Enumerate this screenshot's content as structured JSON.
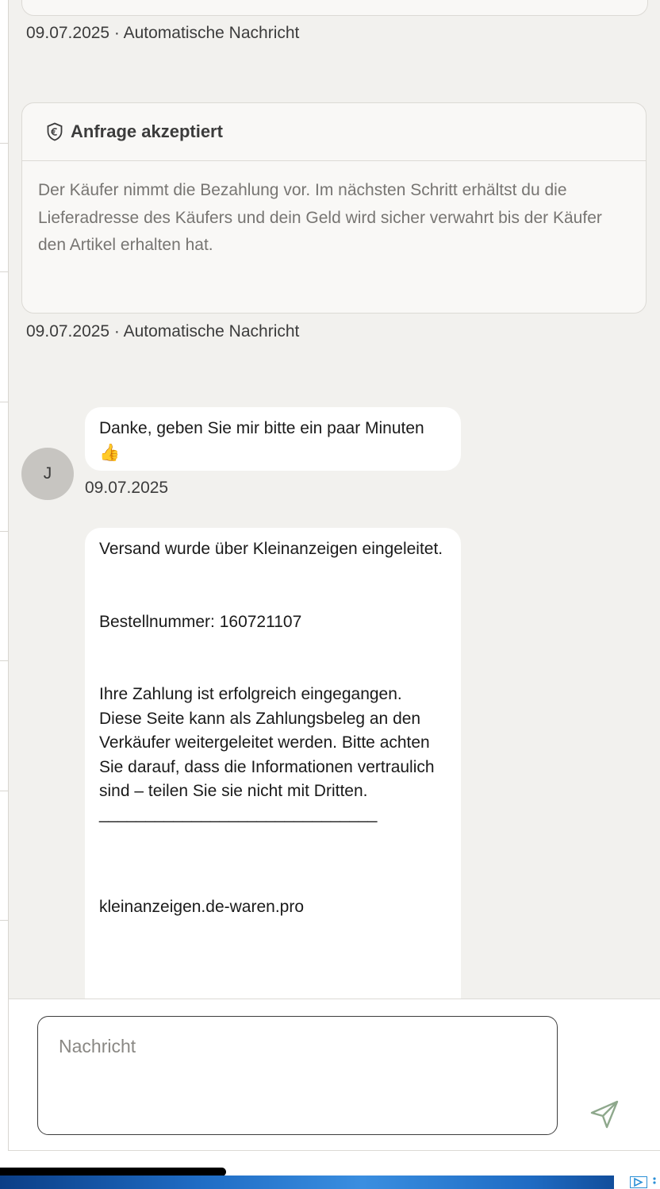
{
  "system_messages": [
    {
      "meta": "09.07.2025 · Automatische Nachricht"
    },
    {
      "title": "Anfrage akzeptiert",
      "body": "Der Käufer nimmt die Bezahlung vor. Im nächsten Schritt erhältst du die Lieferadresse des Käufers und dein Geld wird sicher verwahrt bis der Käufer den Artikel erhalten hat.",
      "meta": "09.07.2025 · Automatische Nachricht"
    }
  ],
  "conversation": {
    "avatar_initial": "J",
    "message1": {
      "text": "Danke, geben Sie mir bitte ein paar Minuten 👍",
      "time": "09.07.2025"
    },
    "message2": {
      "line1": "Versand wurde über Kleinanzeigen eingeleitet.",
      "line2": "Bestellnummer: 160721107",
      "line3": "Ihre Zahlung ist erfolgreich eingegangen. Diese Seite kann als Zahlungsbeleg an den Verkäufer weitergeleitet werden. Bitte achten Sie darauf, dass die Informationen vertraulich sind – teilen Sie sie nicht mit Dritten.",
      "line4": "______________________________",
      "line5": "kleinanzeigen.de-waren.pro"
    }
  },
  "composer": {
    "placeholder": "Nachricht"
  },
  "icons": {
    "shield": "shield-euro-icon",
    "send": "send-icon",
    "ad": "ad-choices-icon"
  },
  "colors": {
    "background": "#f2f1ee",
    "bubble": "#ffffff",
    "card": "#f9f8f6",
    "avatar": "#c7c5c1"
  }
}
